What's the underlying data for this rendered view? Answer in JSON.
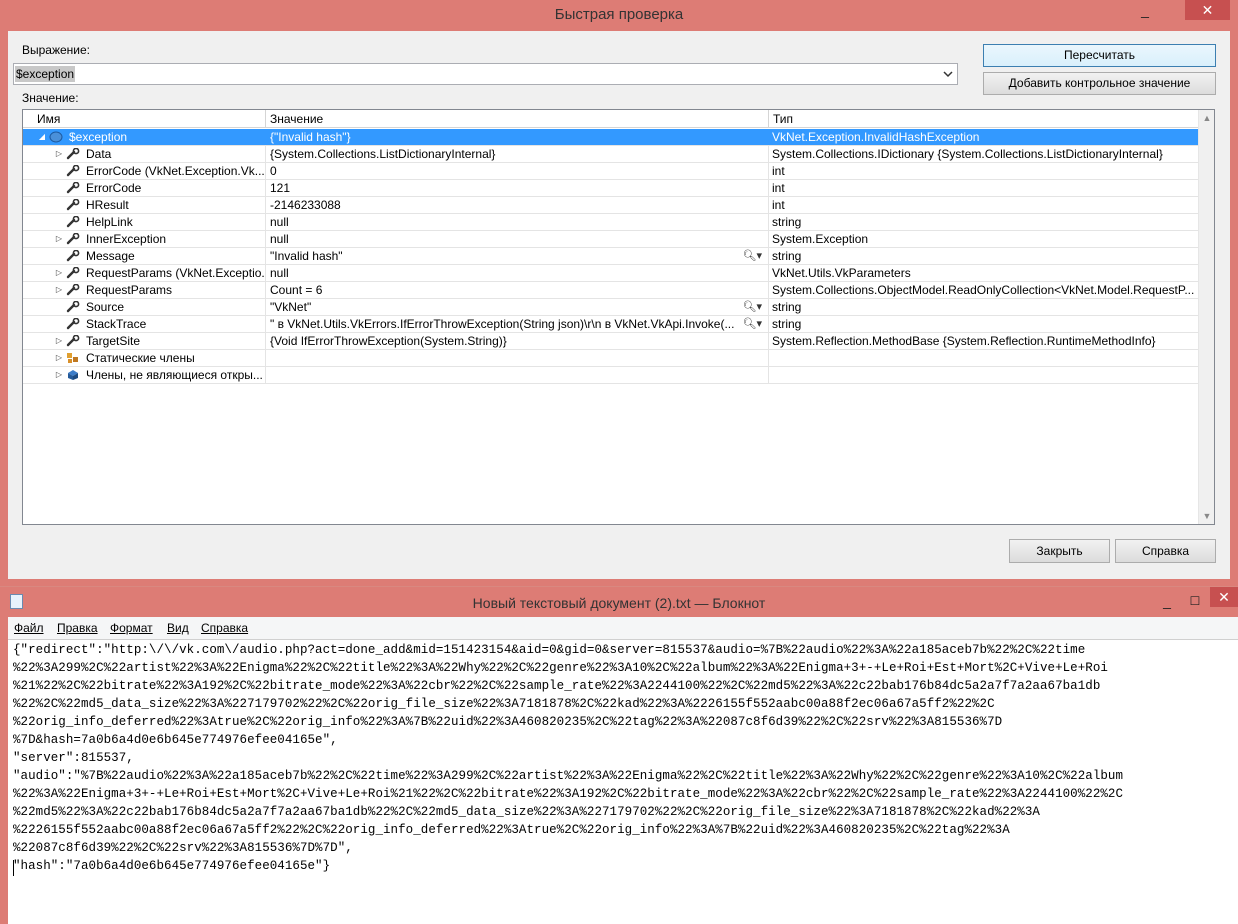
{
  "quickwatch": {
    "title": "Быстрая проверка",
    "expression_label": "Выражение:",
    "expression_value": "$exception",
    "value_label": "Значение:",
    "recalc_button": "Пересчитать",
    "add_watch_button": "Добавить контрольное значение",
    "close_button": "Закрыть",
    "help_button": "Справка",
    "columns": {
      "name": "Имя",
      "value": "Значение",
      "type": "Тип"
    },
    "rows": [
      {
        "name": "$exception",
        "value": "{\"Invalid hash\"}",
        "type": "VkNet.Exception.InvalidHashException",
        "expander": "expanded",
        "icon": "exception-icon",
        "selected": true
      },
      {
        "name": "Data",
        "value": "{System.Collections.ListDictionaryInternal}",
        "type": "System.Collections.IDictionary {System.Collections.ListDictionaryInternal}",
        "expander": "collapsed",
        "icon": "wrench-icon"
      },
      {
        "name": "ErrorCode (VkNet.Exception.Vk...",
        "value": "0",
        "type": "int",
        "expander": "none",
        "icon": "wrench-icon"
      },
      {
        "name": "ErrorCode",
        "value": "121",
        "type": "int",
        "expander": "none",
        "icon": "wrench-icon"
      },
      {
        "name": "HResult",
        "value": "-2146233088",
        "type": "int",
        "expander": "none",
        "icon": "wrench-icon"
      },
      {
        "name": "HelpLink",
        "value": "null",
        "type": "string",
        "expander": "none",
        "icon": "wrench-icon"
      },
      {
        "name": "InnerException",
        "value": "null",
        "type": "System.Exception",
        "expander": "collapsed",
        "icon": "wrench-icon"
      },
      {
        "name": "Message",
        "value": "\"Invalid hash\"",
        "type": "string",
        "expander": "none",
        "icon": "wrench-icon",
        "magnifier": true
      },
      {
        "name": "RequestParams (VkNet.Exceptio...",
        "value": "null",
        "type": "VkNet.Utils.VkParameters",
        "expander": "collapsed",
        "icon": "wrench-icon"
      },
      {
        "name": "RequestParams",
        "value": "Count = 6",
        "type": "System.Collections.ObjectModel.ReadOnlyCollection<VkNet.Model.RequestP...",
        "expander": "collapsed",
        "icon": "wrench-icon"
      },
      {
        "name": "Source",
        "value": "\"VkNet\"",
        "type": "string",
        "expander": "none",
        "icon": "wrench-icon",
        "magnifier": true
      },
      {
        "name": "StackTrace",
        "value": "\"   в VkNet.Utils.VkErrors.IfErrorThrowException(String json)\\r\\n   в VkNet.VkApi.Invoke(...",
        "type": "string",
        "expander": "none",
        "icon": "wrench-icon",
        "magnifier": true
      },
      {
        "name": "TargetSite",
        "value": "{Void IfErrorThrowException(System.String)}",
        "type": "System.Reflection.MethodBase {System.Reflection.RuntimeMethodInfo}",
        "expander": "collapsed",
        "icon": "wrench-icon"
      },
      {
        "name": "Статические члены",
        "value": "",
        "type": "",
        "expander": "collapsed",
        "icon": "static-members-icon"
      },
      {
        "name": "Члены, не являющиеся откры...",
        "value": "",
        "type": "",
        "expander": "collapsed",
        "icon": "nonpublic-members-icon"
      }
    ]
  },
  "notepad": {
    "title": "Новый текстовый документ (2).txt — Блокнот",
    "menu": [
      "Файл",
      "Правка",
      "Формат",
      "Вид",
      "Справка"
    ],
    "lines": [
      "{\"redirect\":\"http:\\/\\/vk.com\\/audio.php?act=done_add&mid=151423154&aid=0&gid=0&server=815537&audio=%7B%22audio%22%3A%22a185aceb7b%22%2C%22time",
      "%22%3A299%2C%22artist%22%3A%22Enigma%22%2C%22title%22%3A%22Why%22%2C%22genre%22%3A10%2C%22album%22%3A%22Enigma+3+-+Le+Roi+Est+Mort%2C+Vive+Le+Roi",
      "%21%22%2C%22bitrate%22%3A192%2C%22bitrate_mode%22%3A%22cbr%22%2C%22sample_rate%22%3A2244100%22%2C%22md5%22%3A%22c22bab176b84dc5a2a7f7a2aa67ba1db",
      "%22%2C%22md5_data_size%22%3A%227179702%22%2C%22orig_file_size%22%3A7181878%2C%22kad%22%3A%2226155f552aabc00a88f2ec06a67a5ff2%22%2C",
      "%22orig_info_deferred%22%3Atrue%2C%22orig_info%22%3A%7B%22uid%22%3A460820235%2C%22tag%22%3A%22087c8f6d39%22%2C%22srv%22%3A815536%7D",
      "%7D&hash=7a0b6a4d0e6b645e774976efee04165e\",",
      "\"server\":815537,",
      "\"audio\":\"%7B%22audio%22%3A%22a185aceb7b%22%2C%22time%22%3A299%2C%22artist%22%3A%22Enigma%22%2C%22title%22%3A%22Why%22%2C%22genre%22%3A10%2C%22album",
      "%22%3A%22Enigma+3+-+Le+Roi+Est+Mort%2C+Vive+Le+Roi%21%22%2C%22bitrate%22%3A192%2C%22bitrate_mode%22%3A%22cbr%22%2C%22sample_rate%22%3A2244100%22%2C",
      "%22md5%22%3A%22c22bab176b84dc5a2a7f7a2aa67ba1db%22%2C%22md5_data_size%22%3A%227179702%22%2C%22orig_file_size%22%3A7181878%2C%22kad%22%3A",
      "%2226155f552aabc00a88f2ec06a67a5ff2%22%2C%22orig_info_deferred%22%3Atrue%2C%22orig_info%22%3A%7B%22uid%22%3A460820235%2C%22tag%22%3A",
      "%22087c8f6d39%22%2C%22srv%22%3A815536%7D%7D\",",
      "\"hash\":\"7a0b6a4d0e6b645e774976efee04165e\"}"
    ]
  }
}
